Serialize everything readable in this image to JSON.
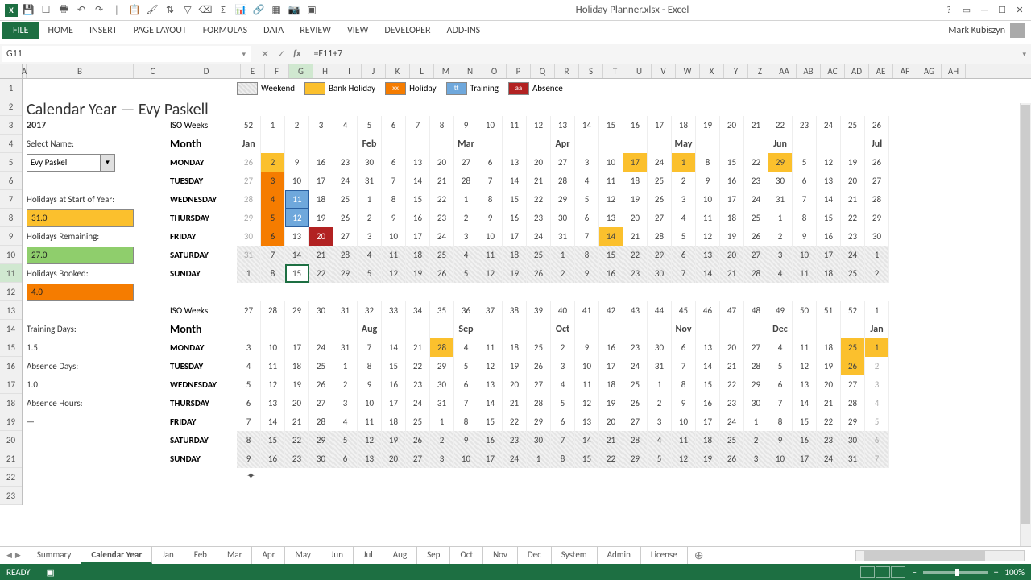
{
  "app": {
    "title": "Holiday Planner.xlsx - Excel",
    "user": "Mark Kubiszyn"
  },
  "ribbon": {
    "file": "FILE",
    "tabs": [
      "HOME",
      "INSERT",
      "PAGE LAYOUT",
      "FORMULAS",
      "DATA",
      "REVIEW",
      "VIEW",
      "DEVELOPER",
      "ADD-INS"
    ]
  },
  "formula": {
    "name_box": "G11",
    "formula": "=F11+7"
  },
  "columns": [
    "A",
    "B",
    "C",
    "D",
    "E",
    "F",
    "G",
    "H",
    "I",
    "J",
    "K",
    "L",
    "M",
    "N",
    "O",
    "P",
    "Q",
    "R",
    "S",
    "T",
    "U",
    "V",
    "W",
    "X",
    "Y",
    "Z",
    "AA",
    "AB",
    "AC",
    "AD",
    "AE",
    "AF",
    "AG",
    "AH"
  ],
  "selected_col": "G",
  "selected_row": 11,
  "legend": {
    "weekend": "Weekend",
    "bank": "Bank Holiday",
    "holiday": "Holiday",
    "training": "Training",
    "absence": "Absence",
    "hol_mark": "xx",
    "tr_mark": "tt",
    "ab_mark": "aa"
  },
  "header": {
    "title": "Calendar Year — Evy Paskell",
    "year": "2017"
  },
  "panel": {
    "select_name_label": "Select Name:",
    "select_name_value": "Evy Paskell",
    "hol_start_label": "Holidays at Start of Year:",
    "hol_start_value": "31.0",
    "hol_rem_label": "Holidays Remaining:",
    "hol_rem_value": "27.0",
    "hol_booked_label": "Holidays Booked:",
    "hol_booked_value": "4.0",
    "training_label": "Training Days:",
    "training_value": "1.5",
    "absence_label": "Absence Days:",
    "absence_value": "1.0",
    "abs_hours_label": "Absence Hours:",
    "abs_hours_value": "—"
  },
  "cal_labels": {
    "iso": "ISO Weeks",
    "month": "Month",
    "days": [
      "MONDAY",
      "TUESDAY",
      "WEDNESDAY",
      "THURSDAY",
      "FRIDAY",
      "SATURDAY",
      "SUNDAY"
    ]
  },
  "iso1": [
    "52",
    "1",
    "2",
    "3",
    "4",
    "5",
    "6",
    "7",
    "8",
    "9",
    "10",
    "11",
    "12",
    "13",
    "14",
    "15",
    "16",
    "17",
    "18",
    "19",
    "20",
    "21",
    "22",
    "23",
    "24",
    "25",
    "26"
  ],
  "months1": {
    "0": "Jan",
    "5": "Feb",
    "9": "Mar",
    "13": "Apr",
    "18": "May",
    "22": "Jun",
    "26": "Jul"
  },
  "grid1": {
    "mon": [
      [
        "26",
        "dim"
      ],
      [
        "2",
        "bh"
      ],
      [
        "9",
        ""
      ],
      [
        "16",
        ""
      ],
      [
        "23",
        ""
      ],
      [
        "30",
        ""
      ],
      [
        "6",
        ""
      ],
      [
        "13",
        ""
      ],
      [
        "20",
        ""
      ],
      [
        "27",
        ""
      ],
      [
        "6",
        ""
      ],
      [
        "13",
        ""
      ],
      [
        "20",
        ""
      ],
      [
        "27",
        ""
      ],
      [
        "3",
        ""
      ],
      [
        "10",
        ""
      ],
      [
        "17",
        "bh"
      ],
      [
        "24",
        ""
      ],
      [
        "1",
        "bh"
      ],
      [
        "8",
        ""
      ],
      [
        "15",
        ""
      ],
      [
        "22",
        ""
      ],
      [
        "29",
        "bh"
      ],
      [
        "5",
        ""
      ],
      [
        "12",
        ""
      ],
      [
        "19",
        ""
      ],
      [
        "26",
        ""
      ]
    ],
    "tue": [
      [
        "27",
        "dim"
      ],
      [
        "3",
        "hol"
      ],
      [
        "10",
        ""
      ],
      [
        "17",
        ""
      ],
      [
        "24",
        ""
      ],
      [
        "31",
        ""
      ],
      [
        "7",
        ""
      ],
      [
        "14",
        ""
      ],
      [
        "21",
        ""
      ],
      [
        "28",
        ""
      ],
      [
        "7",
        ""
      ],
      [
        "14",
        ""
      ],
      [
        "21",
        ""
      ],
      [
        "28",
        ""
      ],
      [
        "4",
        ""
      ],
      [
        "11",
        ""
      ],
      [
        "18",
        ""
      ],
      [
        "25",
        ""
      ],
      [
        "2",
        ""
      ],
      [
        "9",
        ""
      ],
      [
        "16",
        ""
      ],
      [
        "23",
        ""
      ],
      [
        "30",
        ""
      ],
      [
        "6",
        ""
      ],
      [
        "13",
        ""
      ],
      [
        "20",
        ""
      ],
      [
        "27",
        ""
      ]
    ],
    "wed": [
      [
        "28",
        "dim"
      ],
      [
        "4",
        "hol"
      ],
      [
        "11",
        "tr"
      ],
      [
        "18",
        ""
      ],
      [
        "25",
        ""
      ],
      [
        "1",
        ""
      ],
      [
        "8",
        ""
      ],
      [
        "15",
        ""
      ],
      [
        "22",
        ""
      ],
      [
        "1",
        ""
      ],
      [
        "8",
        ""
      ],
      [
        "15",
        ""
      ],
      [
        "22",
        ""
      ],
      [
        "29",
        ""
      ],
      [
        "5",
        ""
      ],
      [
        "12",
        ""
      ],
      [
        "19",
        ""
      ],
      [
        "26",
        ""
      ],
      [
        "3",
        ""
      ],
      [
        "10",
        ""
      ],
      [
        "17",
        ""
      ],
      [
        "24",
        ""
      ],
      [
        "31",
        ""
      ],
      [
        "7",
        ""
      ],
      [
        "14",
        ""
      ],
      [
        "21",
        ""
      ],
      [
        "28",
        ""
      ]
    ],
    "thu": [
      [
        "29",
        "dim"
      ],
      [
        "5",
        "hol"
      ],
      [
        "12",
        "tr"
      ],
      [
        "19",
        ""
      ],
      [
        "26",
        ""
      ],
      [
        "2",
        ""
      ],
      [
        "9",
        ""
      ],
      [
        "16",
        ""
      ],
      [
        "23",
        ""
      ],
      [
        "2",
        ""
      ],
      [
        "9",
        ""
      ],
      [
        "16",
        ""
      ],
      [
        "23",
        ""
      ],
      [
        "30",
        ""
      ],
      [
        "6",
        ""
      ],
      [
        "13",
        ""
      ],
      [
        "20",
        ""
      ],
      [
        "27",
        ""
      ],
      [
        "4",
        ""
      ],
      [
        "11",
        ""
      ],
      [
        "18",
        ""
      ],
      [
        "25",
        ""
      ],
      [
        "1",
        ""
      ],
      [
        "8",
        ""
      ],
      [
        "15",
        ""
      ],
      [
        "22",
        ""
      ],
      [
        "29",
        ""
      ]
    ],
    "fri": [
      [
        "30",
        "dim"
      ],
      [
        "6",
        "hol"
      ],
      [
        "13",
        ""
      ],
      [
        "20",
        "ab"
      ],
      [
        "27",
        ""
      ],
      [
        "3",
        ""
      ],
      [
        "10",
        ""
      ],
      [
        "17",
        ""
      ],
      [
        "24",
        ""
      ],
      [
        "3",
        ""
      ],
      [
        "10",
        ""
      ],
      [
        "17",
        ""
      ],
      [
        "24",
        ""
      ],
      [
        "31",
        ""
      ],
      [
        "7",
        ""
      ],
      [
        "14",
        "bh"
      ],
      [
        "21",
        ""
      ],
      [
        "28",
        ""
      ],
      [
        "5",
        ""
      ],
      [
        "12",
        ""
      ],
      [
        "19",
        ""
      ],
      [
        "26",
        ""
      ],
      [
        "2",
        ""
      ],
      [
        "9",
        ""
      ],
      [
        "16",
        ""
      ],
      [
        "23",
        ""
      ],
      [
        "30",
        ""
      ]
    ],
    "sat": [
      [
        "31",
        "dim wknd"
      ],
      [
        "7",
        "wknd"
      ],
      [
        "14",
        "wknd"
      ],
      [
        "21",
        "wknd"
      ],
      [
        "28",
        "wknd"
      ],
      [
        "4",
        "wknd"
      ],
      [
        "11",
        "wknd"
      ],
      [
        "18",
        "wknd"
      ],
      [
        "25",
        "wknd"
      ],
      [
        "4",
        "wknd"
      ],
      [
        "11",
        "wknd"
      ],
      [
        "18",
        "wknd"
      ],
      [
        "25",
        "wknd"
      ],
      [
        "1",
        "wknd"
      ],
      [
        "8",
        "wknd"
      ],
      [
        "15",
        "wknd"
      ],
      [
        "22",
        "wknd"
      ],
      [
        "29",
        "wknd"
      ],
      [
        "6",
        "wknd"
      ],
      [
        "13",
        "wknd"
      ],
      [
        "20",
        "wknd"
      ],
      [
        "27",
        "wknd"
      ],
      [
        "3",
        "wknd"
      ],
      [
        "10",
        "wknd"
      ],
      [
        "17",
        "wknd"
      ],
      [
        "24",
        "wknd"
      ],
      [
        "1",
        "wknd"
      ]
    ],
    "sun": [
      [
        "1",
        "wknd"
      ],
      [
        "8",
        "wknd"
      ],
      [
        "15",
        "wknd sel"
      ],
      [
        "22",
        "wknd"
      ],
      [
        "29",
        "wknd"
      ],
      [
        "5",
        "wknd"
      ],
      [
        "12",
        "wknd"
      ],
      [
        "19",
        "wknd"
      ],
      [
        "26",
        "wknd"
      ],
      [
        "5",
        "wknd"
      ],
      [
        "12",
        "wknd"
      ],
      [
        "19",
        "wknd"
      ],
      [
        "26",
        "wknd"
      ],
      [
        "2",
        "wknd"
      ],
      [
        "9",
        "wknd"
      ],
      [
        "16",
        "wknd"
      ],
      [
        "23",
        "wknd"
      ],
      [
        "30",
        "wknd"
      ],
      [
        "7",
        "wknd"
      ],
      [
        "14",
        "wknd"
      ],
      [
        "21",
        "wknd"
      ],
      [
        "28",
        "wknd"
      ],
      [
        "4",
        "wknd"
      ],
      [
        "11",
        "wknd"
      ],
      [
        "18",
        "wknd"
      ],
      [
        "25",
        "wknd"
      ],
      [
        "2",
        "wknd"
      ]
    ]
  },
  "iso2": [
    "27",
    "28",
    "29",
    "30",
    "31",
    "32",
    "33",
    "34",
    "35",
    "36",
    "37",
    "38",
    "39",
    "40",
    "41",
    "42",
    "43",
    "44",
    "45",
    "46",
    "47",
    "48",
    "49",
    "50",
    "51",
    "52",
    "1"
  ],
  "months2": {
    "0": "",
    "5": "Aug",
    "9": "Sep",
    "13": "Oct",
    "18": "Nov",
    "22": "Dec",
    "26": "Jan"
  },
  "grid2": {
    "mon": [
      [
        "3",
        ""
      ],
      [
        "10",
        ""
      ],
      [
        "17",
        ""
      ],
      [
        "24",
        ""
      ],
      [
        "31",
        ""
      ],
      [
        "7",
        ""
      ],
      [
        "14",
        ""
      ],
      [
        "21",
        ""
      ],
      [
        "28",
        "bh"
      ],
      [
        "4",
        ""
      ],
      [
        "11",
        ""
      ],
      [
        "18",
        ""
      ],
      [
        "25",
        ""
      ],
      [
        "2",
        ""
      ],
      [
        "9",
        ""
      ],
      [
        "16",
        ""
      ],
      [
        "23",
        ""
      ],
      [
        "30",
        ""
      ],
      [
        "6",
        ""
      ],
      [
        "13",
        ""
      ],
      [
        "20",
        ""
      ],
      [
        "27",
        ""
      ],
      [
        "4",
        ""
      ],
      [
        "11",
        ""
      ],
      [
        "18",
        ""
      ],
      [
        "25",
        "bh"
      ],
      [
        "1",
        "bh"
      ]
    ],
    "tue": [
      [
        "4",
        ""
      ],
      [
        "11",
        ""
      ],
      [
        "18",
        ""
      ],
      [
        "25",
        ""
      ],
      [
        "1",
        ""
      ],
      [
        "8",
        ""
      ],
      [
        "15",
        ""
      ],
      [
        "22",
        ""
      ],
      [
        "29",
        ""
      ],
      [
        "5",
        ""
      ],
      [
        "12",
        ""
      ],
      [
        "19",
        ""
      ],
      [
        "26",
        ""
      ],
      [
        "3",
        ""
      ],
      [
        "10",
        ""
      ],
      [
        "17",
        ""
      ],
      [
        "24",
        ""
      ],
      [
        "31",
        ""
      ],
      [
        "7",
        ""
      ],
      [
        "14",
        ""
      ],
      [
        "21",
        ""
      ],
      [
        "28",
        ""
      ],
      [
        "5",
        ""
      ],
      [
        "12",
        ""
      ],
      [
        "19",
        ""
      ],
      [
        "26",
        "bh"
      ],
      [
        "2",
        "dim"
      ]
    ],
    "wed": [
      [
        "5",
        ""
      ],
      [
        "12",
        ""
      ],
      [
        "19",
        ""
      ],
      [
        "26",
        ""
      ],
      [
        "2",
        ""
      ],
      [
        "9",
        ""
      ],
      [
        "16",
        ""
      ],
      [
        "23",
        ""
      ],
      [
        "30",
        ""
      ],
      [
        "6",
        ""
      ],
      [
        "13",
        ""
      ],
      [
        "20",
        ""
      ],
      [
        "27",
        ""
      ],
      [
        "4",
        ""
      ],
      [
        "11",
        ""
      ],
      [
        "18",
        ""
      ],
      [
        "25",
        ""
      ],
      [
        "1",
        ""
      ],
      [
        "8",
        ""
      ],
      [
        "15",
        ""
      ],
      [
        "22",
        ""
      ],
      [
        "29",
        ""
      ],
      [
        "6",
        ""
      ],
      [
        "13",
        ""
      ],
      [
        "20",
        ""
      ],
      [
        "27",
        ""
      ],
      [
        "3",
        "dim"
      ]
    ],
    "thu": [
      [
        "6",
        ""
      ],
      [
        "13",
        ""
      ],
      [
        "20",
        ""
      ],
      [
        "27",
        ""
      ],
      [
        "3",
        ""
      ],
      [
        "10",
        ""
      ],
      [
        "17",
        ""
      ],
      [
        "24",
        ""
      ],
      [
        "31",
        ""
      ],
      [
        "7",
        ""
      ],
      [
        "14",
        ""
      ],
      [
        "21",
        ""
      ],
      [
        "28",
        ""
      ],
      [
        "5",
        ""
      ],
      [
        "12",
        ""
      ],
      [
        "19",
        ""
      ],
      [
        "26",
        ""
      ],
      [
        "2",
        ""
      ],
      [
        "9",
        ""
      ],
      [
        "16",
        ""
      ],
      [
        "23",
        ""
      ],
      [
        "30",
        ""
      ],
      [
        "7",
        ""
      ],
      [
        "14",
        ""
      ],
      [
        "21",
        ""
      ],
      [
        "28",
        ""
      ],
      [
        "4",
        "dim"
      ]
    ],
    "fri": [
      [
        "7",
        ""
      ],
      [
        "14",
        ""
      ],
      [
        "21",
        ""
      ],
      [
        "28",
        ""
      ],
      [
        "4",
        ""
      ],
      [
        "11",
        ""
      ],
      [
        "18",
        ""
      ],
      [
        "25",
        ""
      ],
      [
        "1",
        ""
      ],
      [
        "8",
        ""
      ],
      [
        "15",
        ""
      ],
      [
        "22",
        ""
      ],
      [
        "29",
        ""
      ],
      [
        "6",
        ""
      ],
      [
        "13",
        ""
      ],
      [
        "20",
        ""
      ],
      [
        "27",
        ""
      ],
      [
        "3",
        ""
      ],
      [
        "10",
        ""
      ],
      [
        "17",
        ""
      ],
      [
        "24",
        ""
      ],
      [
        "1",
        ""
      ],
      [
        "8",
        ""
      ],
      [
        "15",
        ""
      ],
      [
        "22",
        ""
      ],
      [
        "29",
        ""
      ],
      [
        "5",
        "dim"
      ]
    ],
    "sat": [
      [
        "8",
        "wknd"
      ],
      [
        "15",
        "wknd"
      ],
      [
        "22",
        "wknd"
      ],
      [
        "29",
        "wknd"
      ],
      [
        "5",
        "wknd"
      ],
      [
        "12",
        "wknd"
      ],
      [
        "19",
        "wknd"
      ],
      [
        "26",
        "wknd"
      ],
      [
        "2",
        "wknd"
      ],
      [
        "9",
        "wknd"
      ],
      [
        "16",
        "wknd"
      ],
      [
        "23",
        "wknd"
      ],
      [
        "30",
        "wknd"
      ],
      [
        "7",
        "wknd"
      ],
      [
        "14",
        "wknd"
      ],
      [
        "21",
        "wknd"
      ],
      [
        "28",
        "wknd"
      ],
      [
        "4",
        "wknd"
      ],
      [
        "11",
        "wknd"
      ],
      [
        "18",
        "wknd"
      ],
      [
        "25",
        "wknd"
      ],
      [
        "2",
        "wknd"
      ],
      [
        "9",
        "wknd"
      ],
      [
        "16",
        "wknd"
      ],
      [
        "23",
        "wknd"
      ],
      [
        "30",
        "wknd"
      ],
      [
        "6",
        "dim wknd"
      ]
    ],
    "sun": [
      [
        "9",
        "wknd"
      ],
      [
        "16",
        "wknd"
      ],
      [
        "23",
        "wknd"
      ],
      [
        "30",
        "wknd"
      ],
      [
        "6",
        "wknd"
      ],
      [
        "13",
        "wknd"
      ],
      [
        "20",
        "wknd"
      ],
      [
        "27",
        "wknd"
      ],
      [
        "3",
        "wknd"
      ],
      [
        "10",
        "wknd"
      ],
      [
        "17",
        "wknd"
      ],
      [
        "24",
        "wknd"
      ],
      [
        "1",
        "wknd"
      ],
      [
        "8",
        "wknd"
      ],
      [
        "15",
        "wknd"
      ],
      [
        "22",
        "wknd"
      ],
      [
        "29",
        "wknd"
      ],
      [
        "5",
        "wknd"
      ],
      [
        "12",
        "wknd"
      ],
      [
        "19",
        "wknd"
      ],
      [
        "26",
        "wknd"
      ],
      [
        "3",
        "wknd"
      ],
      [
        "10",
        "wknd"
      ],
      [
        "17",
        "wknd"
      ],
      [
        "24",
        "wknd"
      ],
      [
        "31",
        "wknd"
      ],
      [
        "7",
        "dim wknd"
      ]
    ]
  },
  "sheets": {
    "tabs": [
      "Summary",
      "Calendar Year",
      "Jan",
      "Feb",
      "Mar",
      "Apr",
      "May",
      "Jun",
      "Jul",
      "Aug",
      "Sep",
      "Oct",
      "Nov",
      "Dec",
      "System",
      "Admin",
      "License"
    ],
    "active": "Calendar Year"
  },
  "status": {
    "ready": "READY",
    "zoom": "100%"
  }
}
